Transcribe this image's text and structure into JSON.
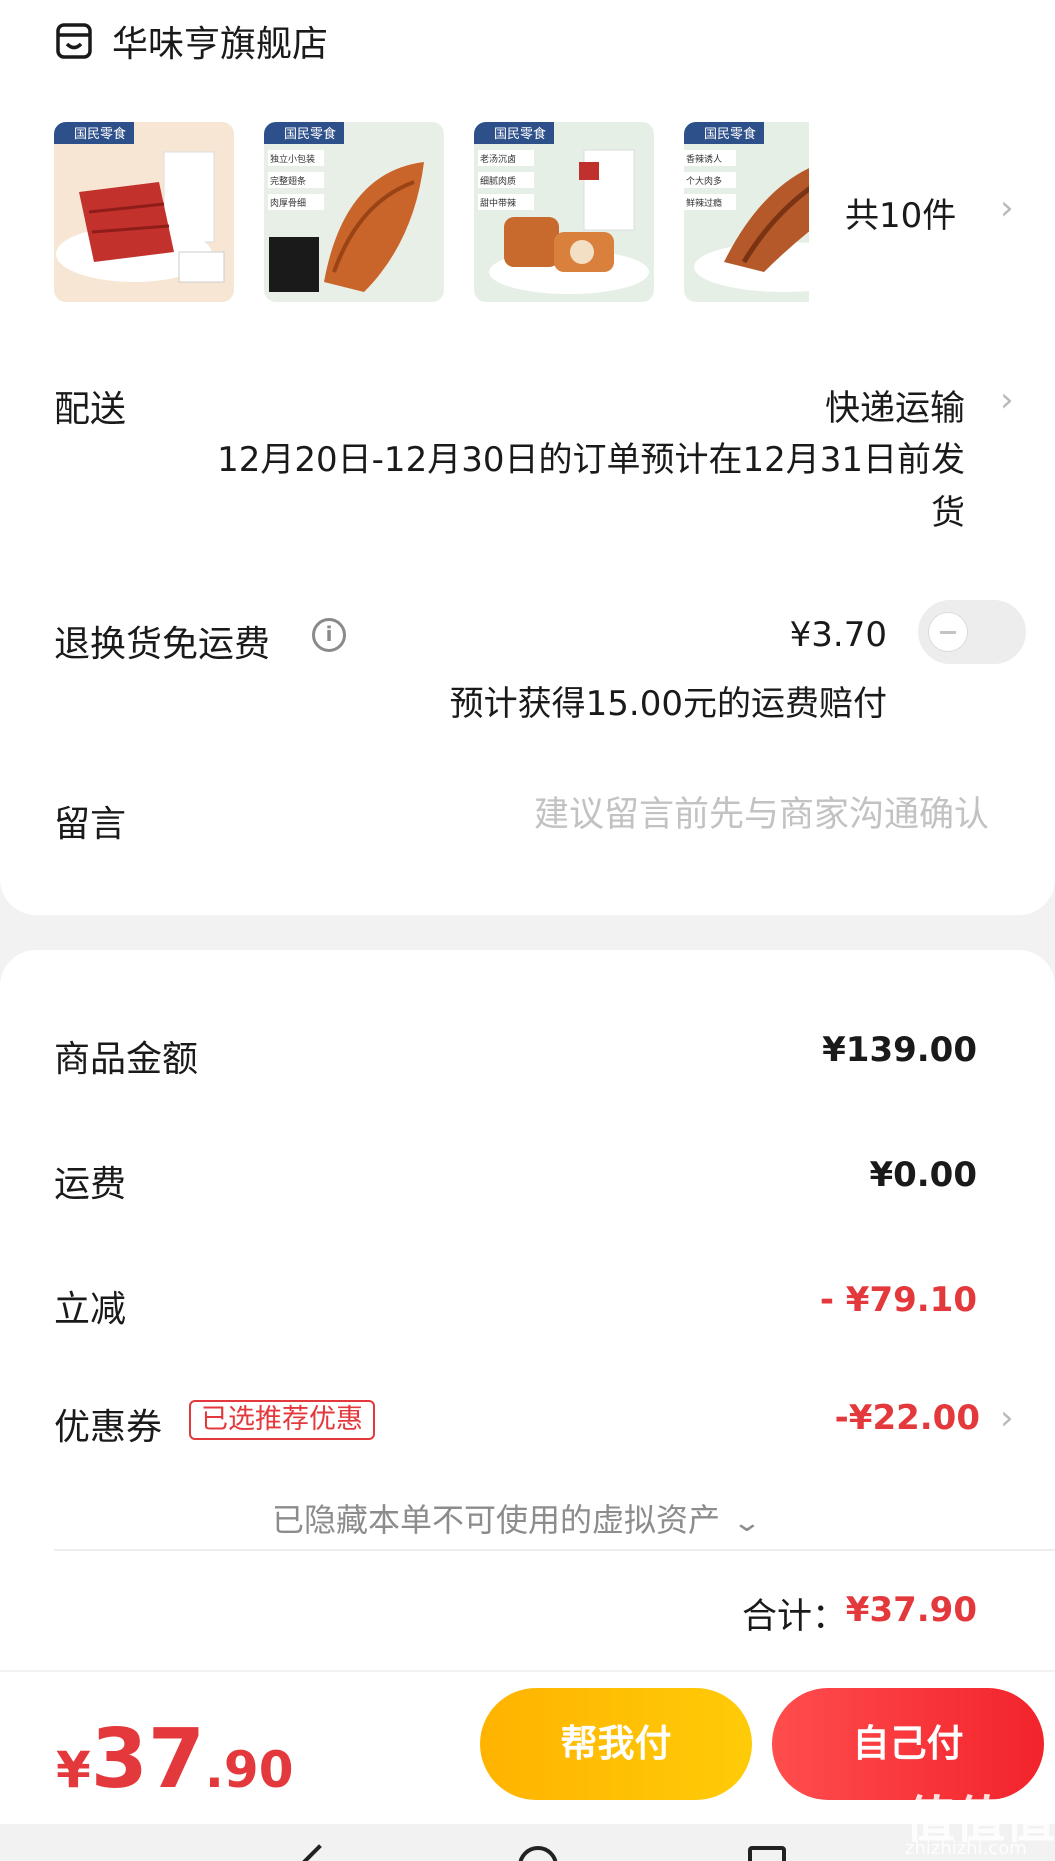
{
  "shop": {
    "name": "华味亨旗舰店",
    "icon": "shop-icon"
  },
  "items": {
    "count_label": "共10件",
    "thumbnails": [
      {
        "brand": "国民零食",
        "tags": []
      },
      {
        "brand": "国民零食",
        "tags": [
          "独立小包装",
          "完整翅条",
          "肉厚骨细"
        ]
      },
      {
        "brand": "国民零食",
        "tags": [
          "老汤沉卤",
          "细腻肉质",
          "甜中带辣"
        ]
      },
      {
        "brand": "国民零食",
        "tags": [
          "香辣诱人",
          "个大肉多",
          "鲜辣过瘾"
        ]
      }
    ]
  },
  "delivery": {
    "label": "配送",
    "method": "快递运输",
    "note": "12月20日-12月30日的订单预计在12月31日前发货"
  },
  "return_insurance": {
    "label": "退换货免运费",
    "price": "¥3.70",
    "note": "预计获得15.00元的运费赔付",
    "enabled": false
  },
  "message": {
    "label": "留言",
    "placeholder": "建议留言前先与商家沟通确认"
  },
  "summary": {
    "goods_label": "商品金额",
    "goods_value": "¥139.00",
    "shipping_label": "运费",
    "shipping_value": "¥0.00",
    "discount_label": "立减",
    "discount_value": "- ¥79.10",
    "coupon_label": "优惠券",
    "coupon_badge": "已选推荐优惠",
    "coupon_value": "-¥22.00",
    "hidden_assets": "已隐藏本单不可使用的虚拟资产",
    "total_label": "合计：",
    "total_value": "¥37.90"
  },
  "pay": {
    "currency": "¥",
    "amount_int": "37",
    "amount_dec": ".90",
    "help_pay": "帮我付",
    "self_pay": "自己付"
  },
  "watermark": {
    "text": "值值值",
    "url": "zhizhizhi.com"
  },
  "colors": {
    "accent_red": "#e4393c",
    "help_button": "#ffb300",
    "self_button": "#f2232c"
  }
}
